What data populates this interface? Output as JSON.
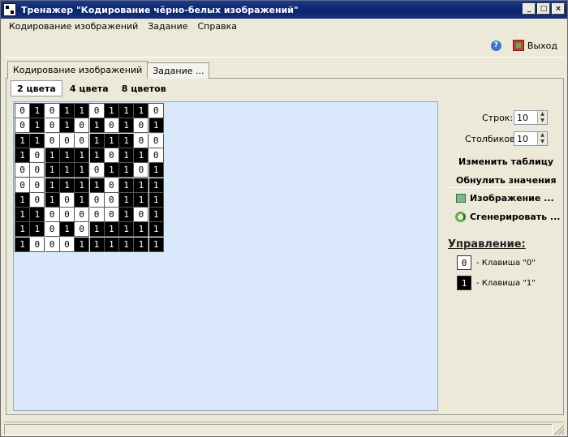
{
  "window": {
    "title": "Тренажер \"Кодирование чёрно-белых изображений\"",
    "controls": [
      "_",
      "□",
      "×"
    ]
  },
  "menu": [
    "Кодирование изображений",
    "Задание",
    "Справка"
  ],
  "toolbar": {
    "help_icon": "help-icon",
    "exit_label": "Выход"
  },
  "main_tabs": [
    "Кодирование изображений",
    "Задание ..."
  ],
  "sub_tabs": [
    "2 цвета",
    "4 цвета",
    "8 цветов"
  ],
  "grid": {
    "rows": [
      [
        0,
        1,
        0,
        1,
        1,
        0,
        1,
        1,
        1,
        0
      ],
      [
        0,
        1,
        0,
        1,
        0,
        1,
        0,
        1,
        0,
        1
      ],
      [
        1,
        1,
        0,
        0,
        0,
        1,
        1,
        1,
        0,
        0
      ],
      [
        1,
        0,
        1,
        1,
        1,
        1,
        0,
        1,
        1,
        0
      ],
      [
        0,
        0,
        1,
        1,
        1,
        0,
        1,
        1,
        0,
        1
      ],
      [
        0,
        0,
        1,
        1,
        1,
        1,
        0,
        1,
        1,
        1
      ],
      [
        1,
        0,
        1,
        0,
        1,
        0,
        0,
        1,
        1,
        1
      ],
      [
        1,
        1,
        0,
        0,
        0,
        0,
        0,
        1,
        0,
        1
      ],
      [
        1,
        1,
        0,
        1,
        0,
        1,
        1,
        1,
        1,
        1
      ],
      [
        1,
        0,
        0,
        0,
        1,
        1,
        1,
        1,
        1,
        1
      ]
    ]
  },
  "settings": {
    "rows_label": "Строк:",
    "rows_value": "10",
    "cols_label": "Столбиков:",
    "cols_value": "10",
    "change_table": "Изменить таблицу",
    "reset_values": "Обнулить значения",
    "image_button": "Изображение ...",
    "generate_button": "Сгенерировать ..."
  },
  "controls_help": {
    "title": "Управление:",
    "key0_symbol": "0",
    "key0_text": "- Клавиша \"0\"",
    "key1_symbol": "1",
    "key1_text": "- Клавиша \"1\""
  },
  "colors": {
    "title_bar": "#0a246a",
    "canvas_bg": "#dae8fc",
    "window_bg": "#ece9d8"
  }
}
